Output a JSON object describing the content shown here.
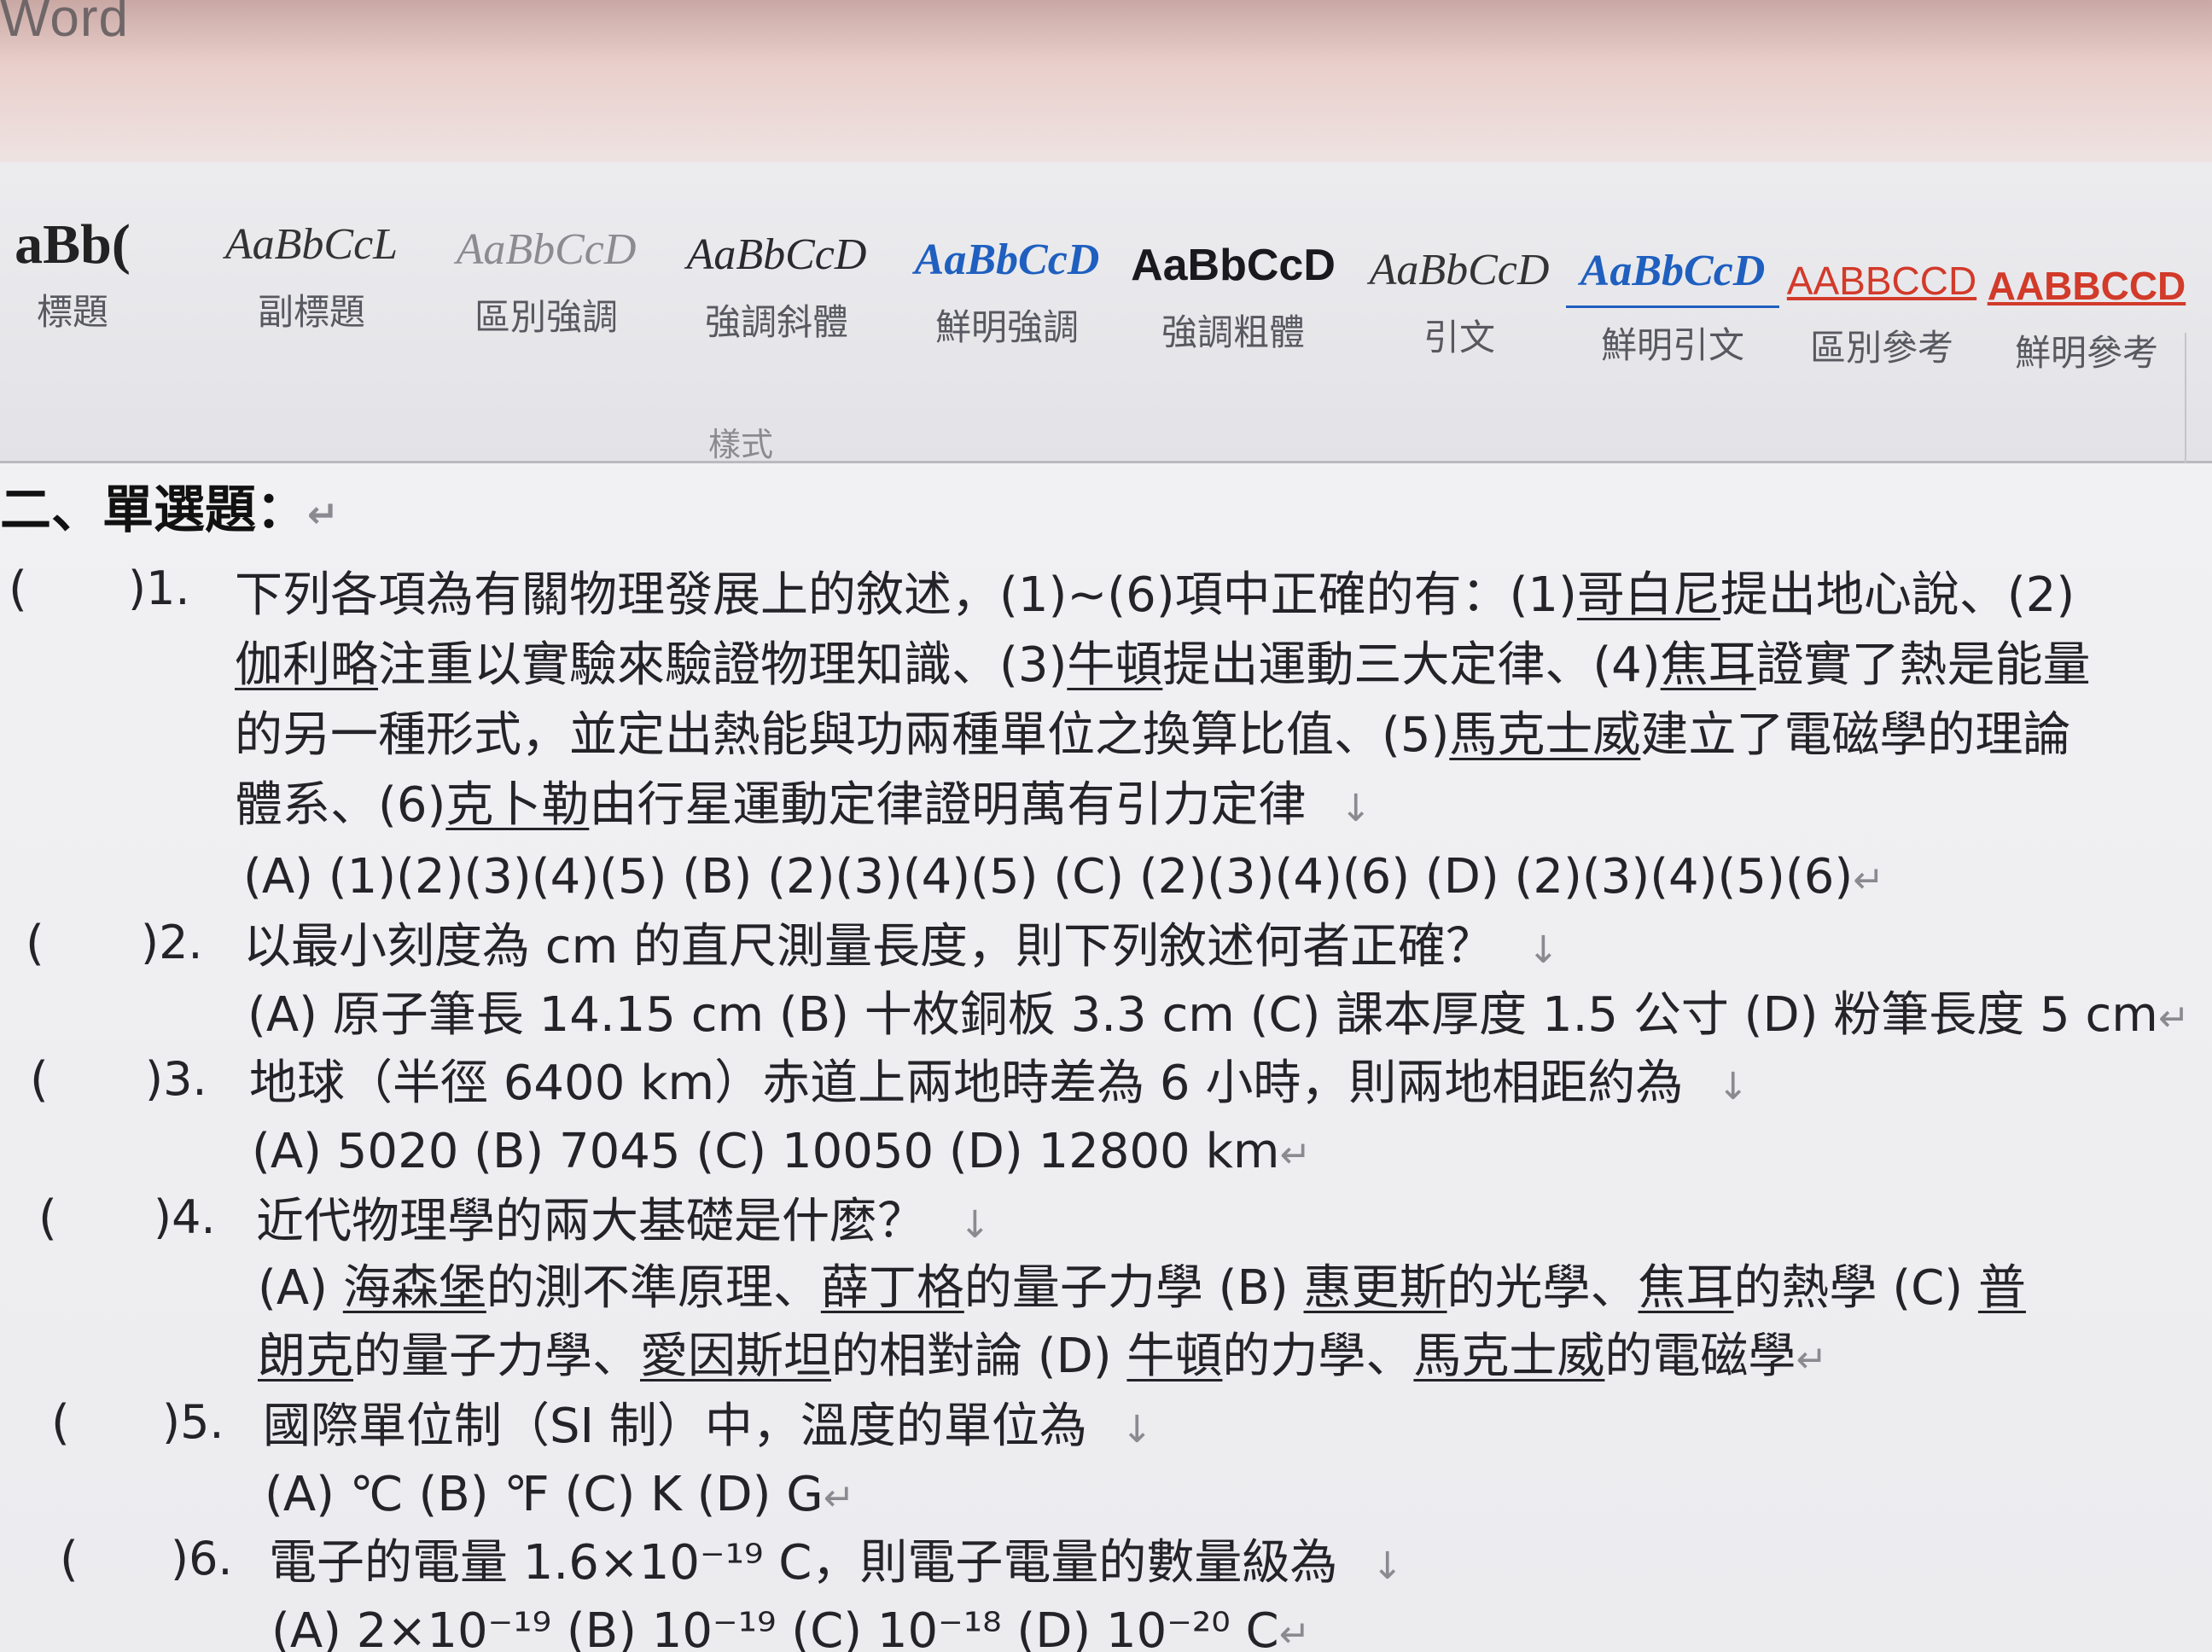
{
  "app": {
    "title": "Word"
  },
  "ribbon": {
    "styles": [
      {
        "sample": "aBb(",
        "name": "標題"
      },
      {
        "sample": "AaBbCcL",
        "name": "副標題"
      },
      {
        "sample": "AaBbCcD",
        "name": "區別強調"
      },
      {
        "sample": "AaBbCcD",
        "name": "強調斜體"
      },
      {
        "sample": "AaBbCcD",
        "name": "鮮明強調"
      },
      {
        "sample": "AaBbCcD",
        "name": "強調粗體"
      },
      {
        "sample": "AaBbCcD",
        "name": "引文"
      },
      {
        "sample": "AaBbCcD",
        "name": "鮮明引文"
      },
      {
        "sample": "AABBCCD",
        "name": "區別參考"
      },
      {
        "sample": "AABBCCD",
        "name": "鮮明參考"
      }
    ],
    "group_label": "樣式"
  },
  "document": {
    "heading": "二、單選題：",
    "paragraph_mark": "↵",
    "line_mark": "↓",
    "questions": [
      {
        "paren": "(",
        "num": ")1.",
        "stem_lines": [
          [
            "下列各項為有關物理發展上的敘述，(1)~(6)項中正確的有：(1)",
            "哥白尼",
            "提出地心說、(2)"
          ],
          [
            "伽利略",
            "注重以實驗來驗證物理知識、(3)",
            "牛頓",
            "提出運動三大定律、(4)",
            "焦耳",
            "證實了熱是能量"
          ],
          [
            "的另一種形式，並定出熱能與功兩種單位之換算比值、(5)",
            "馬克士威",
            "建立了電磁學的理論"
          ],
          [
            "體系、(6)",
            "克卜勒",
            "由行星運動定律證明萬有引力定律"
          ]
        ],
        "options": "(A) (1)(2)(3)(4)(5)    (B) (2)(3)(4)(5)    (C) (2)(3)(4)(6)    (D) (2)(3)(4)(5)(6)"
      },
      {
        "paren": "(",
        "num": ")2.",
        "stem": "以最小刻度為 cm 的直尺測量長度，則下列敘述何者正確？",
        "options": "(A)  原子筆長 14.15 cm    (B)  十枚銅板 3.3 cm    (C)  課本厚度 1.5 公寸    (D)  粉筆長度 5 cm"
      },
      {
        "paren": "(",
        "num": ")3.",
        "stem": "地球（半徑 6400 km）赤道上兩地時差為 6 小時，則兩地相距約為",
        "options": "(A) 5020    (B) 7045    (C) 10050    (D) 12800     km"
      },
      {
        "paren": "(",
        "num": ")4.",
        "stem": "近代物理學的兩大基礎是什麼？",
        "options_lines": [
          [
            "(A) ",
            "海森堡",
            "的測不準原理、",
            "薛丁格",
            "的量子力學    (B) ",
            "惠更斯",
            "的光學、",
            "焦耳",
            "的熱學    (C) ",
            "普"
          ],
          [
            "朗克",
            "的量子力學、",
            "愛因斯坦",
            "的相對論    (D) ",
            "牛頓",
            "的力學、",
            "馬克士威",
            "的電磁學"
          ]
        ]
      },
      {
        "paren": "(",
        "num": ")5.",
        "stem": "國際單位制（SI 制）中，溫度的單位為",
        "options": "(A)  ℃    (B)  ℉    (C) K    (D) G"
      },
      {
        "paren": "(",
        "num": ")6.",
        "stem": "電子的電量 1.6×10⁻¹⁹ C，則電子電量的數量級為",
        "options": "(A) 2×10⁻¹⁹    (B) 10⁻¹⁹    (C) 10⁻¹⁸    (D) 10⁻²⁰    C"
      }
    ]
  },
  "colors": {
    "accent_blue": "#1f5fbf",
    "reference_red": "#d23a2a",
    "titlebar_pink": "#e9cfcb"
  }
}
